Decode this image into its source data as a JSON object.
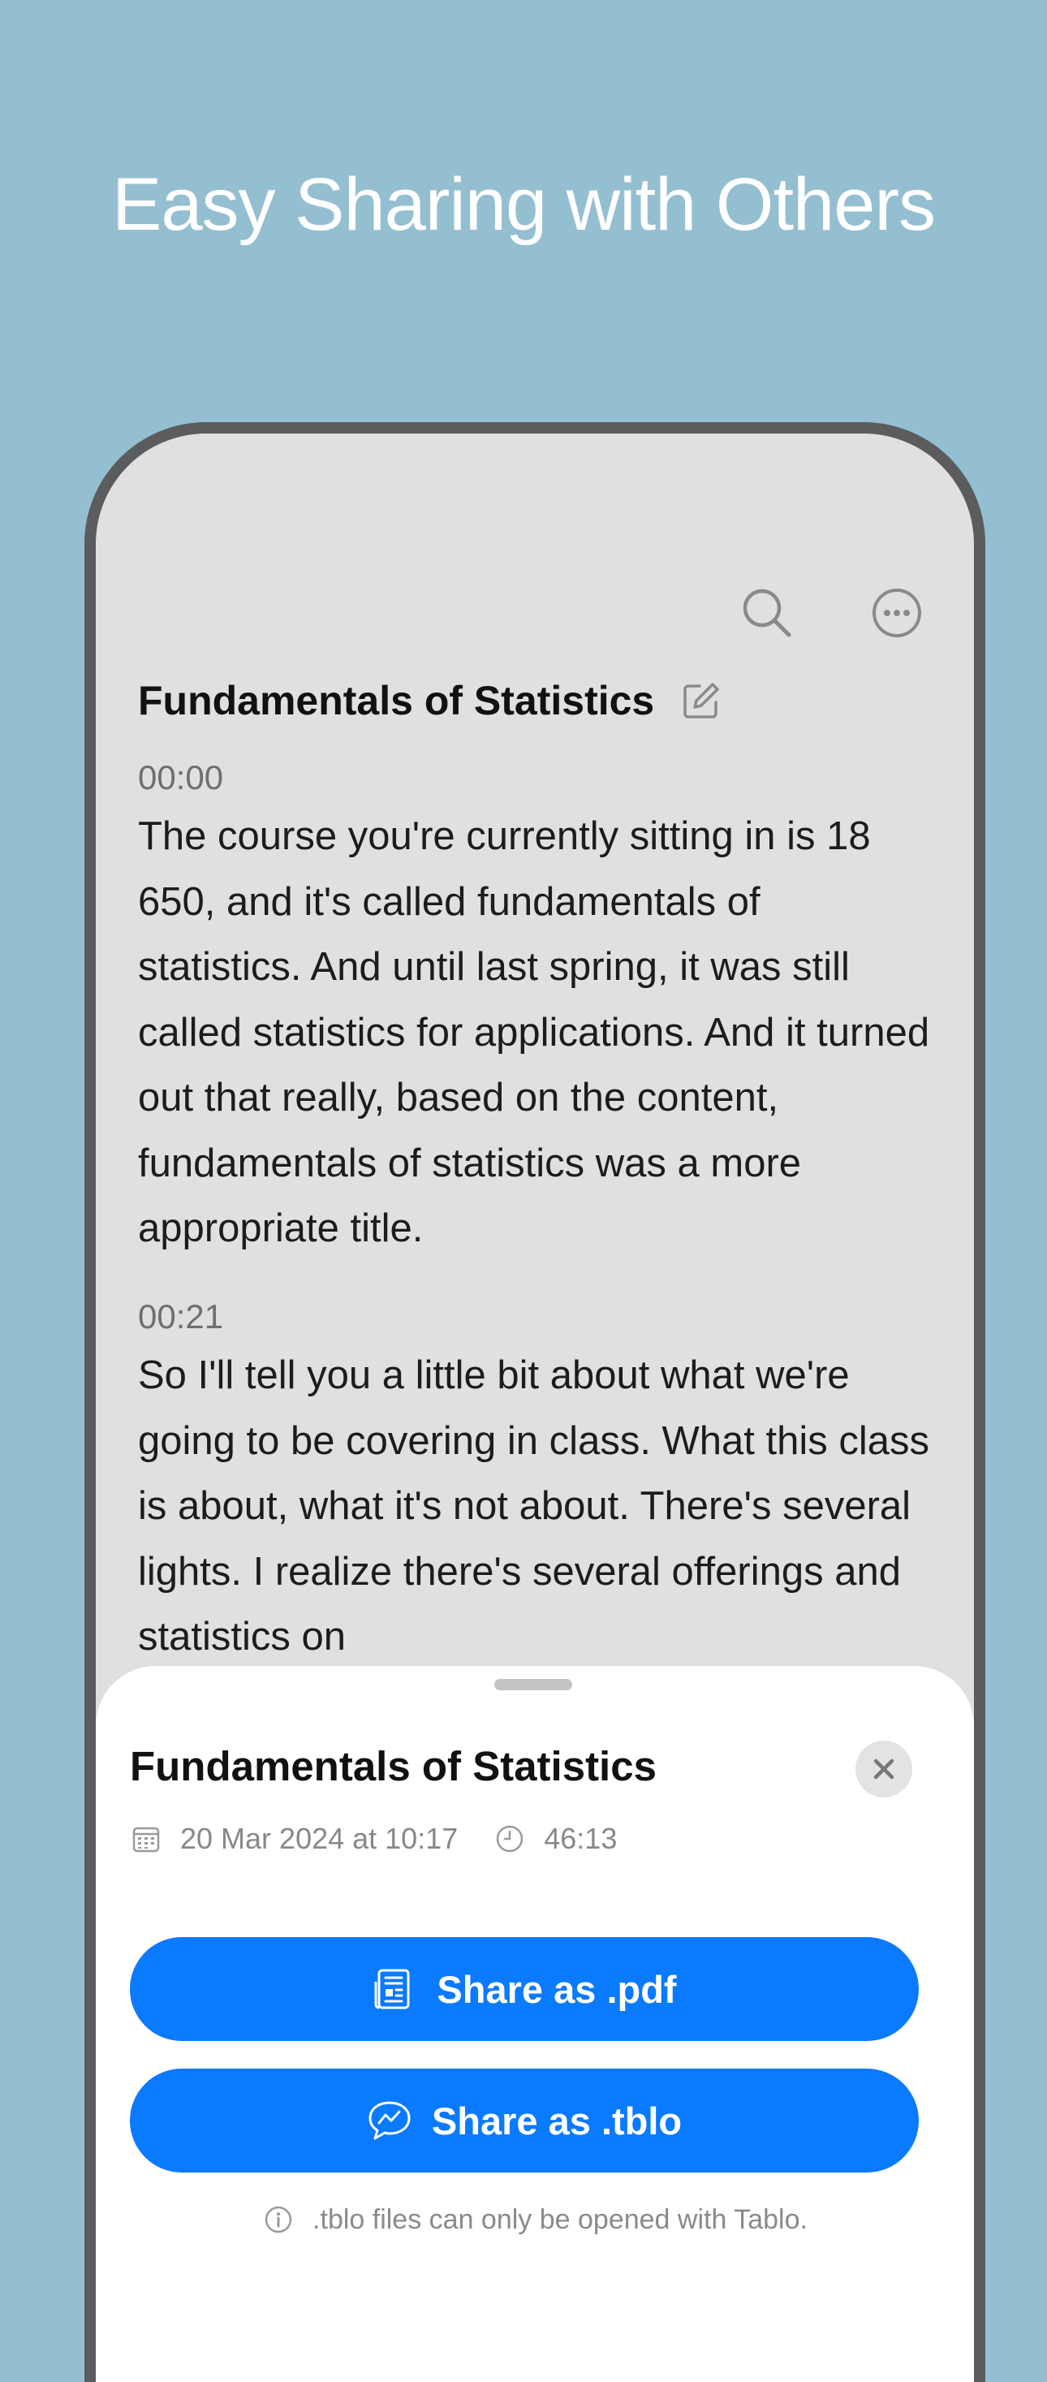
{
  "headline": "Easy Sharing with Others",
  "colors": {
    "background": "#94bfd1",
    "accent": "#0a7aff",
    "phone_frame": "#5a5c5e",
    "screen": "#e0e0e0"
  },
  "toolbar": {
    "search_icon": "magnifying-glass",
    "more_icon": "ellipsis-circle"
  },
  "document": {
    "title": "Fundamentals of Statistics",
    "edit_icon": "square-and-pencil",
    "segments": [
      {
        "time": "00:00",
        "text": "The course you're currently sitting in is 18 650, and it's called fundamentals of statistics. And until last spring, it was still called statistics for applications. And it turned out that really, based on the content, fundamentals of statistics was a more appropriate title."
      },
      {
        "time": "00:21",
        "text": "So I'll tell you a little bit about what we're going to be covering in class. What this class is about, what it's not about. There's several lights. I realize there's several offerings and statistics on"
      }
    ]
  },
  "share_sheet": {
    "title": "Fundamentals of Statistics",
    "date": "20 Mar 2024 at 10:17",
    "duration": "46:13",
    "share_pdf_label": "Share as .pdf",
    "share_tblo_label": "Share as .tblo",
    "note": ".tblo files can only be opened with Tablo."
  }
}
